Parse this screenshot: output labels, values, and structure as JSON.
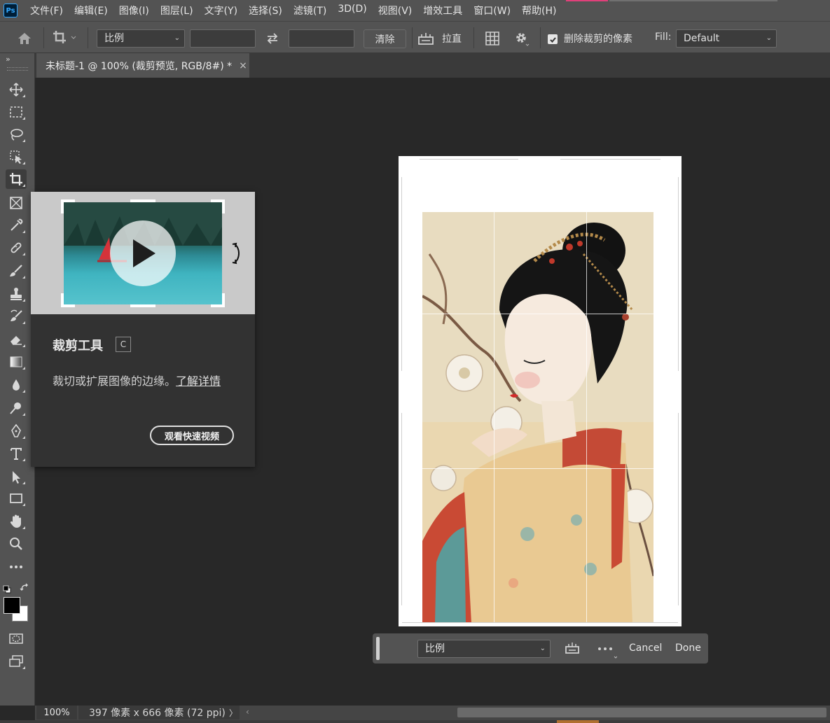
{
  "app": {
    "logo": "Ps",
    "menu": [
      "文件(F)",
      "编辑(E)",
      "图像(I)",
      "图层(L)",
      "文字(Y)",
      "选择(S)",
      "滤镜(T)",
      "3D(D)",
      "视图(V)",
      "增效工具",
      "窗口(W)",
      "帮助(H)"
    ]
  },
  "options": {
    "ratio_select": "比例",
    "width_value": "",
    "height_value": "",
    "clear_label": "清除",
    "straighten_label": "拉直",
    "delete_cropped_label": "删除裁剪的像素",
    "delete_cropped_checked": true,
    "fill_label": "Fill:",
    "fill_value": "Default"
  },
  "document_tab": {
    "title": "未标题-1 @ 100% (裁剪预览, RGB/8#) *",
    "close": "×"
  },
  "tool_tip": {
    "title": "裁剪工具",
    "shortcut": "C",
    "description": "裁切或扩展图像的边缘。",
    "learn_more": "了解详情",
    "watch_button": "观看快速视频"
  },
  "crop_bar": {
    "ratio_select": "比例",
    "cancel_label": "Cancel",
    "done_label": "Done"
  },
  "status": {
    "zoom": "100%",
    "info": "397 像素 x 666 像素 (72 ppi)"
  },
  "colors": {
    "foreground": "#000000",
    "background": "#ffffff",
    "ui_panel": "#535353",
    "canvas": "#282828"
  },
  "icons": {
    "toolbar": [
      "move-icon",
      "marquee-icon",
      "lasso-icon",
      "object-select-icon",
      "crop-icon",
      "frame-icon",
      "eyedropper-icon",
      "healing-brush-icon",
      "brush-icon",
      "stamp-icon",
      "history-brush-icon",
      "eraser-icon",
      "gradient-icon",
      "blur-icon",
      "dodge-icon",
      "pen-icon",
      "type-icon",
      "path-select-icon",
      "rectangle-icon",
      "hand-icon",
      "zoom-icon",
      "more-tools-icon"
    ]
  }
}
